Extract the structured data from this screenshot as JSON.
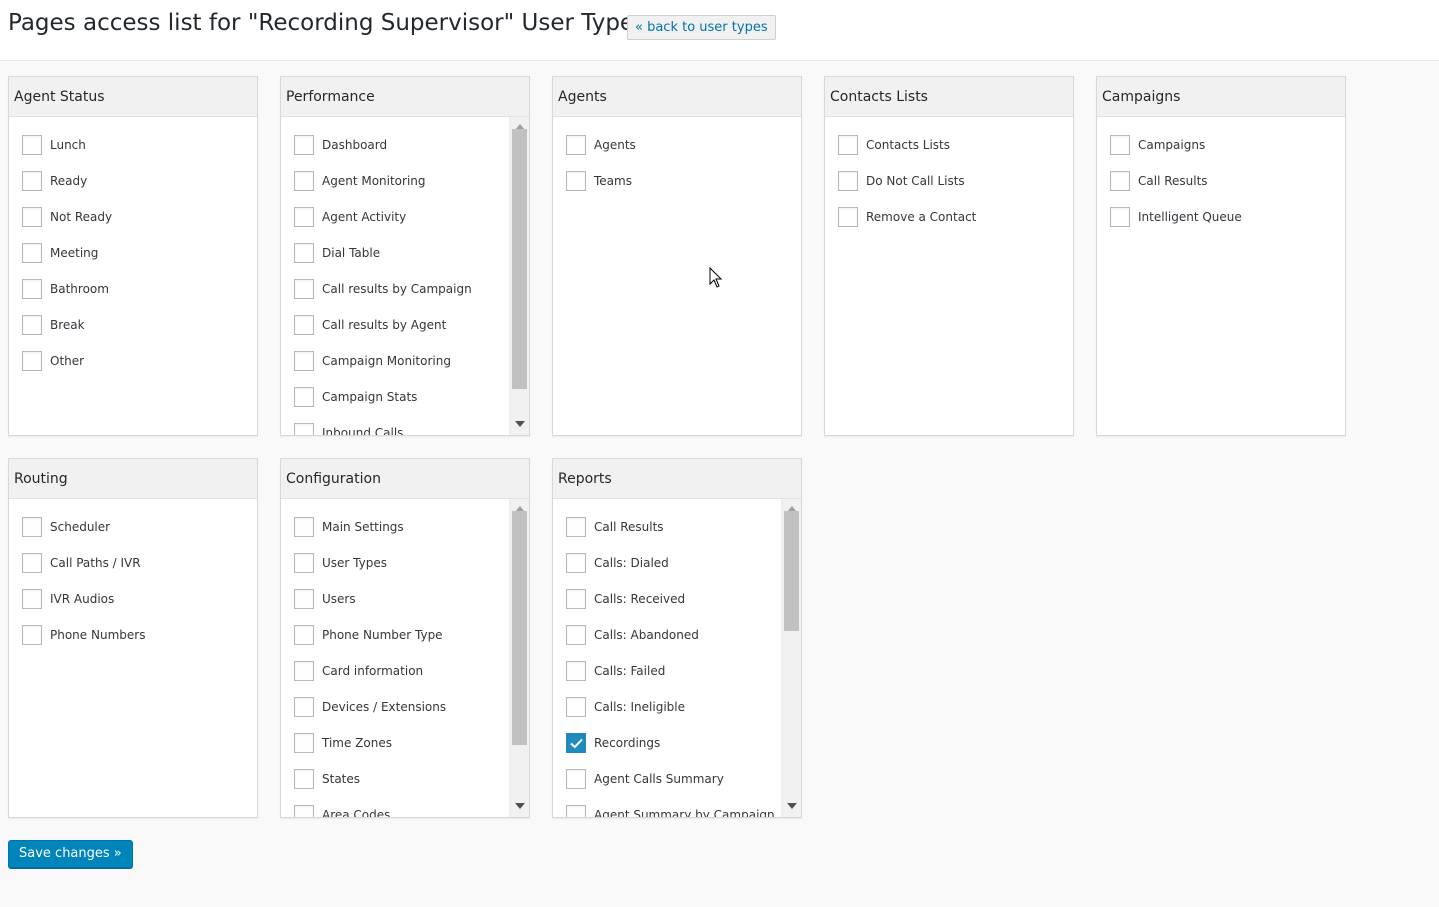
{
  "header": {
    "title": "Pages access list for \"Recording Supervisor\" User Type",
    "back_link": "« back to user types"
  },
  "panels": {
    "agent_status": {
      "title": "Agent Status",
      "items": [
        {
          "label": "Lunch",
          "checked": false
        },
        {
          "label": "Ready",
          "checked": false
        },
        {
          "label": "Not Ready",
          "checked": false
        },
        {
          "label": "Meeting",
          "checked": false
        },
        {
          "label": "Bathroom",
          "checked": false
        },
        {
          "label": "Break",
          "checked": false
        },
        {
          "label": "Other",
          "checked": false
        }
      ]
    },
    "performance": {
      "title": "Performance",
      "items": [
        {
          "label": "Dashboard",
          "checked": false
        },
        {
          "label": "Agent Monitoring",
          "checked": false
        },
        {
          "label": "Agent Activity",
          "checked": false
        },
        {
          "label": "Dial Table",
          "checked": false
        },
        {
          "label": "Call results by Campaign",
          "checked": false
        },
        {
          "label": "Call results by Agent",
          "checked": false
        },
        {
          "label": "Campaign Monitoring",
          "checked": false
        },
        {
          "label": "Campaign Stats",
          "checked": false
        },
        {
          "label": "Inbound Calls",
          "checked": false
        }
      ]
    },
    "agents": {
      "title": "Agents",
      "items": [
        {
          "label": "Agents",
          "checked": false
        },
        {
          "label": "Teams",
          "checked": false
        }
      ]
    },
    "contacts_lists": {
      "title": "Contacts Lists",
      "items": [
        {
          "label": "Contacts Lists",
          "checked": false
        },
        {
          "label": "Do Not Call Lists",
          "checked": false
        },
        {
          "label": "Remove a Contact",
          "checked": false
        }
      ]
    },
    "campaigns": {
      "title": "Campaigns",
      "items": [
        {
          "label": "Campaigns",
          "checked": false
        },
        {
          "label": "Call Results",
          "checked": false
        },
        {
          "label": "Intelligent Queue",
          "checked": false
        }
      ]
    },
    "routing": {
      "title": "Routing",
      "items": [
        {
          "label": "Scheduler",
          "checked": false
        },
        {
          "label": "Call Paths / IVR",
          "checked": false
        },
        {
          "label": "IVR Audios",
          "checked": false
        },
        {
          "label": "Phone Numbers",
          "checked": false
        }
      ]
    },
    "configuration": {
      "title": "Configuration",
      "items": [
        {
          "label": "Main Settings",
          "checked": false
        },
        {
          "label": "User Types",
          "checked": false
        },
        {
          "label": "Users",
          "checked": false
        },
        {
          "label": "Phone Number Type",
          "checked": false
        },
        {
          "label": "Card information",
          "checked": false
        },
        {
          "label": "Devices / Extensions",
          "checked": false
        },
        {
          "label": "Time Zones",
          "checked": false
        },
        {
          "label": "States",
          "checked": false
        },
        {
          "label": "Area Codes",
          "checked": false
        }
      ]
    },
    "reports": {
      "title": "Reports",
      "items": [
        {
          "label": "Call Results",
          "checked": false
        },
        {
          "label": "Calls: Dialed",
          "checked": false
        },
        {
          "label": "Calls: Received",
          "checked": false
        },
        {
          "label": "Calls: Abandoned",
          "checked": false
        },
        {
          "label": "Calls: Failed",
          "checked": false
        },
        {
          "label": "Calls: Ineligible",
          "checked": false
        },
        {
          "label": "Recordings",
          "checked": true
        },
        {
          "label": "Agent Calls Summary",
          "checked": false
        },
        {
          "label": "Agent Summary by Campaign",
          "checked": false
        }
      ]
    }
  },
  "footer": {
    "save_label": "Save changes »"
  },
  "colors": {
    "accent": "#0085ba",
    "link": "#0073aa",
    "checked": "#1e8cbe"
  }
}
